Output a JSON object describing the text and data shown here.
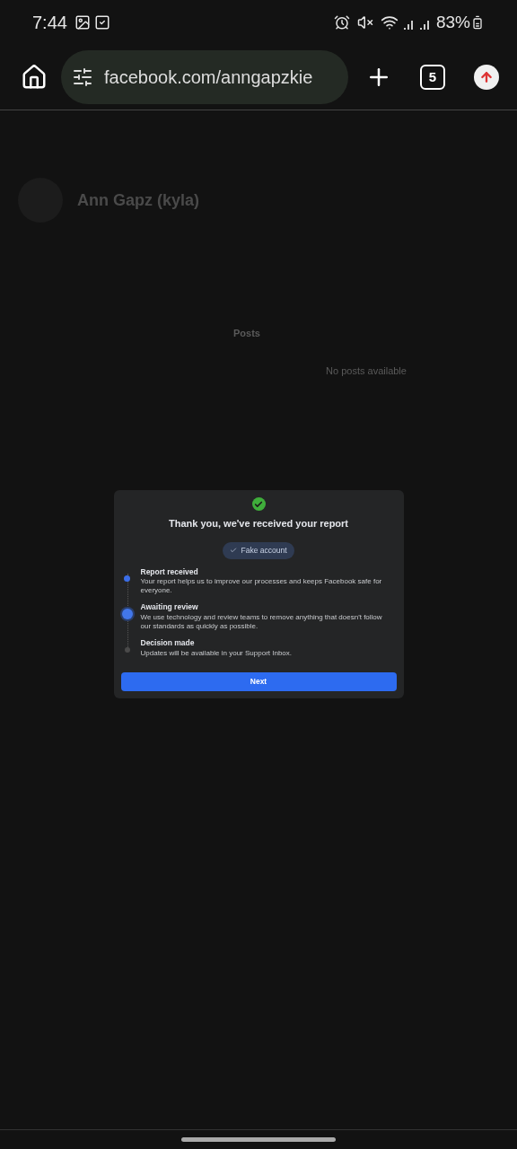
{
  "status_bar": {
    "time": "7:44",
    "battery": "83%"
  },
  "browser": {
    "url": "facebook.com/anngapzkie",
    "tab_count": "5"
  },
  "background_page": {
    "profile_name": "Ann Gapz (kyla)",
    "posts_heading": "Posts",
    "empty_text": "No posts available"
  },
  "dialog": {
    "title": "Thank you, we've received your report",
    "tag": "Fake account",
    "steps": [
      {
        "title": "Report received",
        "text": "Your report helps us to improve our processes and keeps Facebook safe for everyone.",
        "completed": true,
        "current": false
      },
      {
        "title": "Awaiting review",
        "text": "We use technology and review teams to remove anything that doesn't follow our standards as quickly as possible.",
        "completed": false,
        "current": true
      },
      {
        "title": "Decision made",
        "text": "Updates will be available in your Support Inbox.",
        "completed": false,
        "current": false
      }
    ],
    "button": "Next"
  }
}
